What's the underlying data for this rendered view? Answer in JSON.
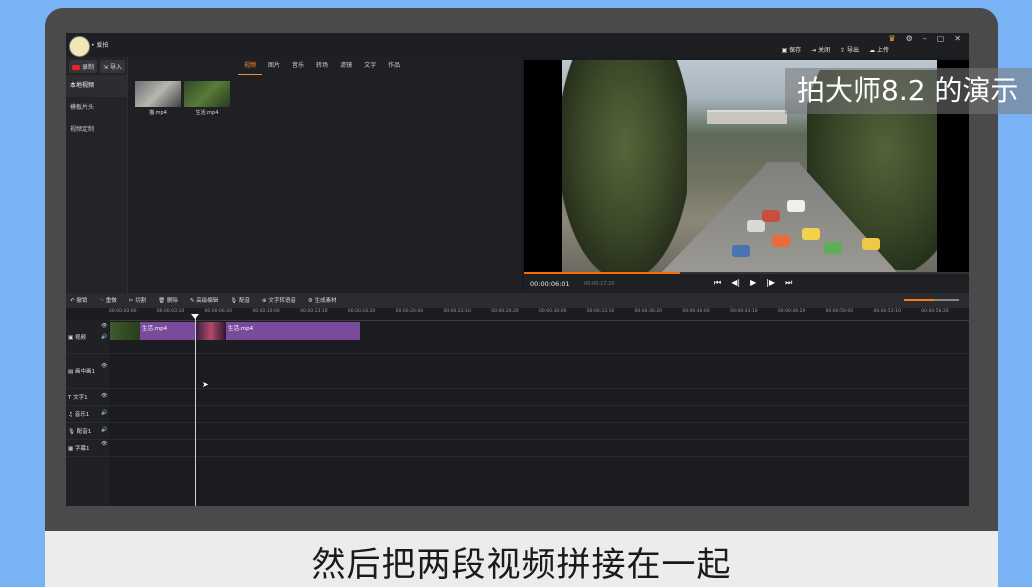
{
  "watermark": "拍大师8.2 的演示",
  "caption": "然后把两段视频拼接在一起",
  "app": {
    "username": "• 爱拍",
    "top_actions": {
      "save": "保存",
      "close": "关闭",
      "export": "导出",
      "upload": "上传"
    },
    "top_icons": [
      "crown-icon",
      "settings-icon",
      "minimize-icon",
      "maximize-icon",
      "close-icon"
    ]
  },
  "library": {
    "record_label": "录制",
    "import_label": "导入",
    "categories": [
      "本地视频",
      "模板片头",
      "视频定制"
    ],
    "tabs": [
      "视频",
      "图片",
      "音乐",
      "转场",
      "滤镜",
      "文字",
      "作品"
    ],
    "active_tab": "视频",
    "clips": [
      {
        "name": "猫.mp4"
      },
      {
        "name": "生活.mp4"
      }
    ]
  },
  "preview": {
    "timecode": "00:00:06:01",
    "duration": "00:00:17:20",
    "progress_fraction": 0.35
  },
  "timeline": {
    "tools": [
      "撤销",
      "重做",
      "切割",
      "删除",
      "高级编辑",
      "配音",
      "文字转语音",
      "生成素材"
    ],
    "ruler_ticks": [
      "00:00:00:00",
      "00:00:03:10",
      "00:00:06:20",
      "00:00:10:00",
      "00:00:13:10",
      "00:00:16:20",
      "00:00:20:00",
      "00:00:23:10",
      "00:00:26:20",
      "00:00:30:00",
      "00:00:33:10",
      "00:00:36:20",
      "00:00:40:00",
      "00:00:43:10",
      "00:00:46:20",
      "00:00:50:00",
      "00:00:53:10",
      "00:00:56:20"
    ],
    "tracks": [
      "视频",
      "画中画1",
      "文字1",
      "音乐1",
      "配音1",
      "字幕1"
    ],
    "clips": [
      {
        "label": "生活.mp4"
      },
      {
        "label": "生活.mp4"
      }
    ],
    "zoom_fraction": 0.55
  }
}
